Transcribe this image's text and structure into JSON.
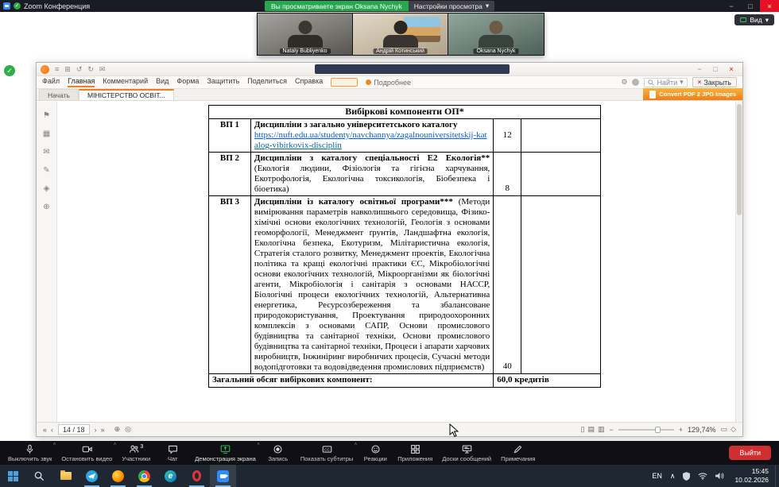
{
  "colors": {
    "share_green": "#28a751",
    "accent_green": "#35b558",
    "leave_red": "#cf2f2f",
    "foxit_orange": "#f47b20",
    "link_blue": "#0563c1"
  },
  "zoom": {
    "titlebar": {
      "title": "Zoom Конференция",
      "banner": "Вы просматриваете экран Oksana Nychyk",
      "view_settings": "Настройки просмотра",
      "view_button": "Вид"
    },
    "participants": [
      "Nataly Bubliyenko",
      "Андрій Котинський",
      "Oksana Nychyk"
    ],
    "controls": [
      {
        "id": "mute",
        "label": "Выключить звук",
        "icon": "mic",
        "caret": true
      },
      {
        "id": "stop-video",
        "label": "Остановить видео",
        "icon": "camera",
        "caret": true
      },
      {
        "id": "participants",
        "label": "Участники",
        "icon": "people",
        "badge": "3"
      },
      {
        "id": "chat",
        "label": "Чат",
        "icon": "chat"
      },
      {
        "id": "share-screen",
        "label": "Демонстрация экрана",
        "icon": "share",
        "accent": true,
        "caret": true
      },
      {
        "id": "record",
        "label": "Запись",
        "icon": "record"
      },
      {
        "id": "captions",
        "label": "Показать субтитры",
        "icon": "cc",
        "caret": true
      },
      {
        "id": "reactions",
        "label": "Реакции",
        "icon": "smile"
      },
      {
        "id": "apps",
        "label": "Приложения",
        "icon": "apps"
      },
      {
        "id": "whiteboards",
        "label": "Доски сообщений",
        "icon": "board"
      },
      {
        "id": "notes",
        "label": "Примечания",
        "icon": "note"
      }
    ],
    "leave_button": "Выйти"
  },
  "pdf": {
    "menu": [
      "Файл",
      "Главная",
      "Комментарий",
      "Вид",
      "Форма",
      "Защитить",
      "Поделиться",
      "Справка"
    ],
    "more_label": "Подробнее",
    "search_label": "Найти",
    "close_label": "Закрыть",
    "convert_label": "Convert PDF 2 JPG Images",
    "tabs": [
      "Начать",
      "МІНІСТЕРСТВО ОСВІТ..."
    ],
    "quick_icons": [
      "menu",
      "save",
      "undo",
      "redo",
      "email"
    ],
    "sidebar_icons": [
      "bookmark",
      "thumbnails",
      "comments",
      "signature",
      "layers",
      "attachments"
    ],
    "status": {
      "page_indicator": "14 / 18",
      "zoom_level": "129,74%",
      "icons": {
        "pre": [
          "first-page",
          "prev-page"
        ],
        "post": [
          "next-page",
          "last-page"
        ],
        "tools": [
          "pan-tool",
          "select-tool"
        ],
        "views": [
          "single-page-view",
          "continuous-view",
          "facing-view"
        ],
        "fit": [
          "fit-width",
          "fit-page"
        ]
      }
    }
  },
  "document": {
    "header": "Вибіркові компоненти ОП*",
    "rows": [
      {
        "code": "ВП 1",
        "title": "Дисципліни з загально університетського каталогу",
        "link": "https://nuft.edu.ua/studenty/navchannya/zagalnouniversitetskij-katalog-vibirkovix-disciplin",
        "credits": "12"
      },
      {
        "code": "ВП 2",
        "title": "Дисципліни з каталогу спеціальності Е2 Екологія**",
        "body": "(Екологія людини, Фізіологія та гігієна харчування, Екотрофологія, Екологічна токсикологія, Біобезпека і біоетика)",
        "credits": "8"
      },
      {
        "code": "ВП 3",
        "title": "Дисципліни із каталогу освітньої програми***",
        "body": "(Методи вимірювання параметрів навколишнього середовища, Фізико-хімічні основи екологічних технологій, Геологія з основами геоморфології, Менеджмент ґрунтів, Ландшафтна екологія, Екологічна безпека, Екотуризм, Мілітаристична екологія, Стратегія сталого розвитку, Менеджмент проектів, Екологічна політика та кращі екологічні практики ЄС, Мікробіологічні основи екологічних технологій, Мікроорганізми як біологічні агенти, Мікробіологія і санітарія з основами НАССР, Біологічні процеси екологічних технологій, Альтернативна енергетика, Ресурсозбереження та збалансоване природокористування, Проектування природоохоронних комплексів з основами САПР, Основи промислового будівництва та санітарної техніки, Основи промислового будівництва та санітарної техніки, Процеси і апарати харчових виробництв, Інжиніринг виробничих процесів, Сучасні методи водопідготовки та водовідведення промислових підприємств)",
        "credits": "40"
      }
    ],
    "footer": {
      "label": "Загальний обсяг вибіркових компонент:",
      "value": "60,0 кредитів"
    }
  },
  "taskbar": {
    "apps": [
      "start",
      "search",
      "explorer",
      "telegram",
      "firefox",
      "chrome",
      "edge",
      "opera",
      "zoom"
    ],
    "running_apps": [
      "telegram",
      "firefox",
      "chrome",
      "opera",
      "zoom"
    ],
    "tray_icons": [
      "hidden-icons",
      "shield",
      "network",
      "volume"
    ],
    "language": "EN",
    "time": "15:45",
    "date": "10.02.2026"
  }
}
